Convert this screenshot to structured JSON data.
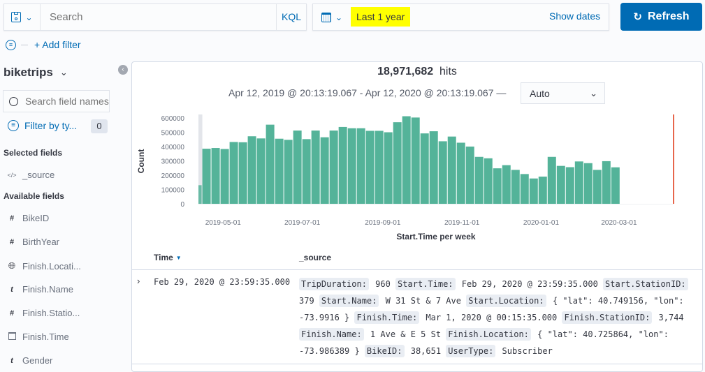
{
  "query_bar": {
    "search_placeholder": "Search",
    "language": "KQL"
  },
  "date_picker": {
    "range": "Last 1 year",
    "show_dates": "Show dates"
  },
  "refresh_label": "Refresh",
  "filter_bar": {
    "add_filter": "+ Add filter"
  },
  "sidebar": {
    "index_pattern": "biketrips",
    "search_placeholder": "Search field names",
    "filter_by_type": "Filter by ty...",
    "filter_count": "0",
    "selected_heading": "Selected fields",
    "selected_fields": [
      {
        "icon": "code",
        "name": "_source"
      }
    ],
    "available_heading": "Available fields",
    "available_fields": [
      {
        "icon": "#",
        "name": "BikeID"
      },
      {
        "icon": "#",
        "name": "BirthYear"
      },
      {
        "icon": "globe",
        "name": "Finish.Locati..."
      },
      {
        "icon": "t",
        "name": "Finish.Name"
      },
      {
        "icon": "#",
        "name": "Finish.Statio..."
      },
      {
        "icon": "calendar",
        "name": "Finish.Time"
      },
      {
        "icon": "t",
        "name": "Gender"
      }
    ]
  },
  "hits": {
    "count": "18,971,682",
    "label": "hits"
  },
  "time_range": "Apr 12, 2019 @ 20:13:19.067 - Apr 12, 2020 @ 20:13:19.067 —",
  "interval": "Auto",
  "chart_data": {
    "type": "bar",
    "xlabel": "Start.Time per week",
    "ylabel": "Count",
    "xlim": [
      "2019-04-12",
      "2020-04-12"
    ],
    "ylim": [
      0,
      600000
    ],
    "yticks": [
      0,
      100000,
      200000,
      300000,
      400000,
      500000,
      600000
    ],
    "xticks": [
      "2019-05-01",
      "2019-07-01",
      "2019-09-01",
      "2019-11-01",
      "2020-01-01",
      "2020-03-01"
    ],
    "bar_color": "#54b399",
    "now_marker_color": "#e7664c",
    "x": [
      "2019-04-08",
      "2019-04-15",
      "2019-04-22",
      "2019-04-29",
      "2019-05-06",
      "2019-05-13",
      "2019-05-20",
      "2019-05-27",
      "2019-06-03",
      "2019-06-10",
      "2019-06-17",
      "2019-06-24",
      "2019-07-01",
      "2019-07-08",
      "2019-07-15",
      "2019-07-22",
      "2019-07-29",
      "2019-08-05",
      "2019-08-12",
      "2019-08-19",
      "2019-08-26",
      "2019-09-02",
      "2019-09-09",
      "2019-09-16",
      "2019-09-23",
      "2019-09-30",
      "2019-10-07",
      "2019-10-14",
      "2019-10-21",
      "2019-10-28",
      "2019-11-04",
      "2019-11-11",
      "2019-11-18",
      "2019-11-25",
      "2019-12-02",
      "2019-12-09",
      "2019-12-16",
      "2019-12-23",
      "2019-12-30",
      "2020-01-06",
      "2020-01-13",
      "2020-01-20",
      "2020-01-27",
      "2020-02-03",
      "2020-02-10",
      "2020-02-17",
      "2020-02-24"
    ],
    "values": [
      130000,
      385000,
      390000,
      383000,
      432000,
      430000,
      472000,
      457000,
      553000,
      455000,
      447000,
      512000,
      452000,
      512000,
      465000,
      512000,
      537000,
      528000,
      528000,
      510000,
      510000,
      500000,
      570000,
      612000,
      603000,
      492000,
      507000,
      437000,
      470000,
      427000,
      400000,
      328000,
      318000,
      248000,
      270000,
      237000,
      208000,
      177000,
      190000,
      328000,
      265000,
      256000,
      296000,
      284000,
      237000,
      298000,
      255000
    ]
  },
  "table": {
    "columns": [
      "Time",
      "_source"
    ],
    "rows": [
      {
        "time": "Feb 29, 2020 @ 23:59:35.000",
        "fields": [
          {
            "k": "TripDuration:",
            "v": "960"
          },
          {
            "k": "Start.Time:",
            "v": "Feb 29, 2020 @ 23:59:35.000"
          },
          {
            "k": "Start.StationID:",
            "v": "379"
          },
          {
            "k": "Start.Name:",
            "v": "W 31 St & 7 Ave"
          },
          {
            "k": "Start.Location:",
            "v": "{ \"lat\": 40.749156, \"lon\": -73.9916 }"
          },
          {
            "k": "Finish.Time:",
            "v": "Mar 1, 2020 @ 00:15:35.000"
          },
          {
            "k": "Finish.StationID:",
            "v": "3,744"
          },
          {
            "k": "Finish.Name:",
            "v": "1 Ave & E 5 St"
          },
          {
            "k": "Finish.Location:",
            "v": "{ \"lat\": 40.725864, \"lon\": -73.986389 }"
          },
          {
            "k": "BikeID:",
            "v": "38,651"
          },
          {
            "k": "UserType:",
            "v": "Subscriber"
          }
        ]
      }
    ]
  }
}
